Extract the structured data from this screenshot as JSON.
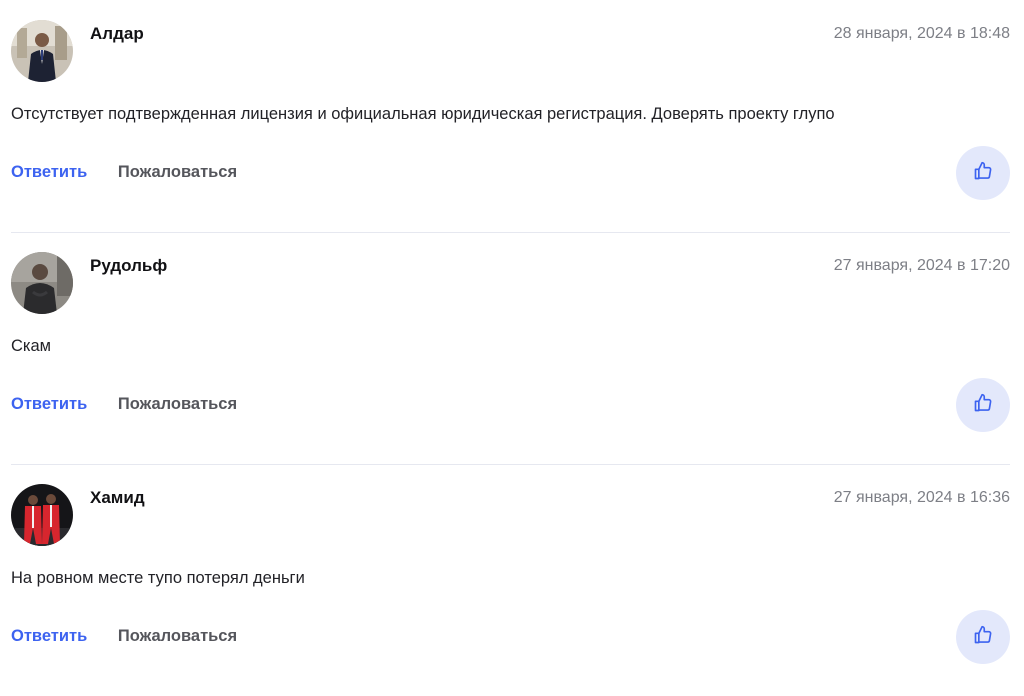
{
  "comments": [
    {
      "author": "Алдар",
      "date": "28 января, 2024 в 18:48",
      "text": "Отсутствует подтвержденная лицензия и официальная юридическая регистрация. Доверять проекту глупо",
      "reply_label": "Ответить",
      "report_label": "Пожаловаться"
    },
    {
      "author": "Рудольф",
      "date": "27 января, 2024 в 17:20",
      "text": "Скам",
      "reply_label": "Ответить",
      "report_label": "Пожаловаться"
    },
    {
      "author": "Хамид",
      "date": "27 января, 2024 в 16:36",
      "text": "На ровном месте тупо потерял деньги",
      "reply_label": "Ответить",
      "report_label": "Пожаловаться"
    }
  ],
  "colors": {
    "accent": "#3d63f0",
    "like_bg": "#e3e8fb",
    "divider": "#e6e8f0",
    "muted": "#7d7f86"
  },
  "icons": {
    "like": "thumbs-up-icon"
  }
}
